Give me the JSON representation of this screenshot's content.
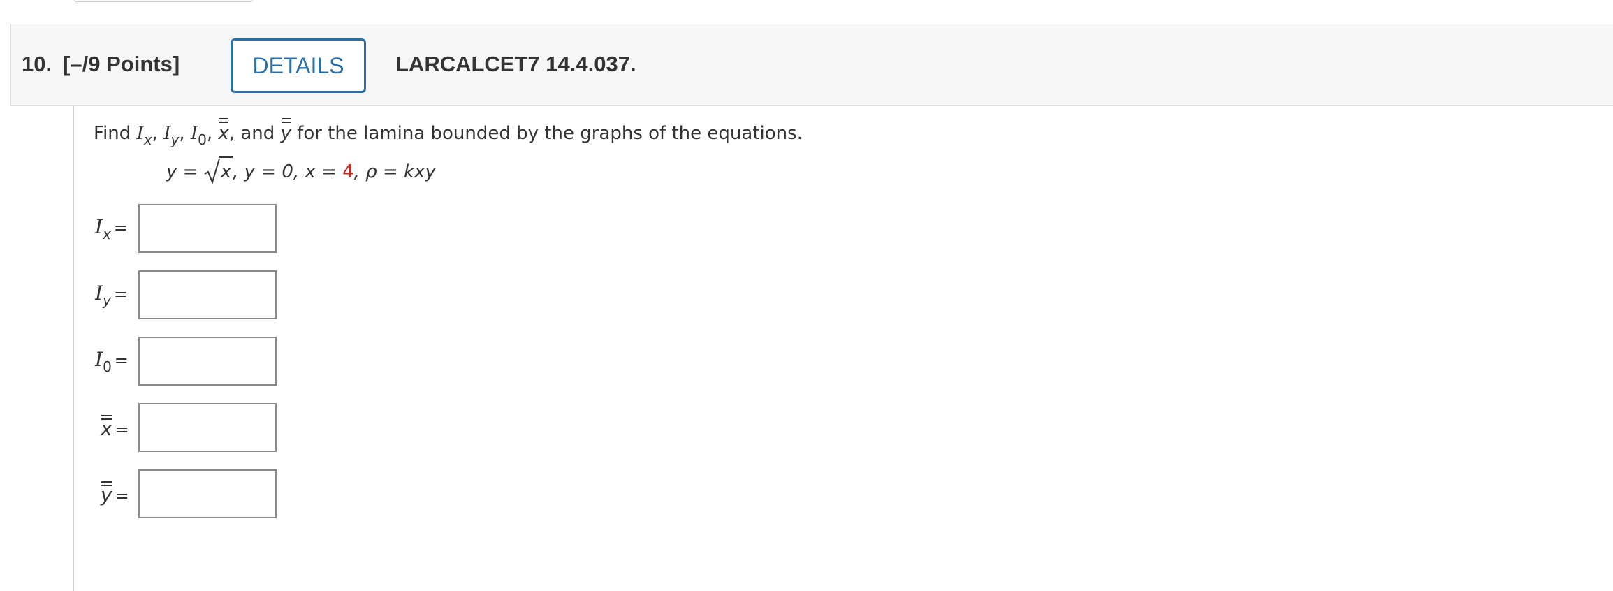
{
  "question": {
    "number": "10.",
    "points": "[–/9 Points]",
    "details_label": "DETAILS",
    "code": "LARCALCET7 14.4.037."
  },
  "prompt": {
    "find": "Find",
    "and": "and",
    "rest": "for the lamina bounded by the graphs of the equations.",
    "sym_I": "I",
    "sub_x": "x",
    "sub_y": "y",
    "sub_0": "0",
    "xbar": "x",
    "ybar": "y"
  },
  "equation": {
    "y_eq": "y = ",
    "sqrt_arg": "x",
    "part2": ", y = 0, x = ",
    "x_value": "4",
    "part3": ", ρ = kxy"
  },
  "answers": [
    {
      "sym": "I",
      "sub": "x",
      "eq": "=",
      "value": ""
    },
    {
      "sym": "I",
      "sub": "y",
      "eq": "=",
      "value": ""
    },
    {
      "sym": "I",
      "sub": "0",
      "eq": "=",
      "value": ""
    },
    {
      "sym": "x",
      "eq": "=",
      "value": ""
    },
    {
      "sym": "y",
      "eq": "=",
      "value": ""
    }
  ],
  "colors": {
    "accent": "#2b6fa8",
    "highlight": "#c8261c",
    "header_bg": "#f6f6f6"
  }
}
